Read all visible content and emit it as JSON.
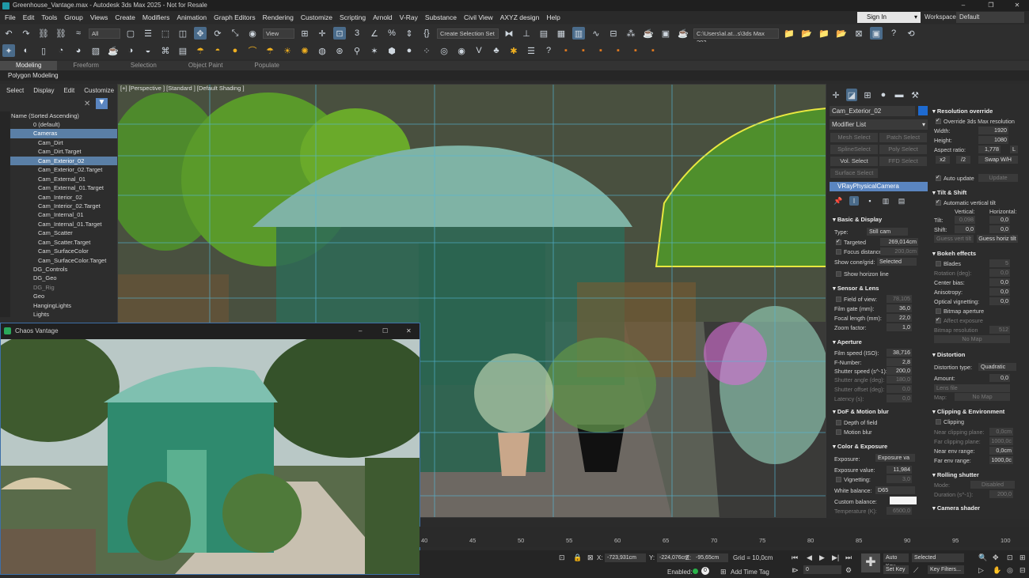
{
  "window": {
    "title": "Greenhouse_Vantage.max - Autodesk 3ds Max 2025 - Not for Resale"
  },
  "menu": [
    "File",
    "Edit",
    "Tools",
    "Group",
    "Views",
    "Create",
    "Modifiers",
    "Animation",
    "Graph Editors",
    "Rendering",
    "Customize",
    "Scripting",
    "Arnold",
    "V-Ray",
    "Substance",
    "Civil View",
    "AXYZ design",
    "Help"
  ],
  "account": {
    "sign_in": "Sign In",
    "workspaces_label": "Workspaces:",
    "workspace": "Default"
  },
  "toolbar": {
    "filter": "All",
    "view": "View",
    "selection_set": "Create Selection Set",
    "path": "C:\\Users\\al.at...s\\3ds Max 202"
  },
  "ribbon": {
    "tabs": [
      "Modeling",
      "Freeform",
      "Selection",
      "Object Paint",
      "Populate"
    ],
    "active": "Modeling",
    "subtitle": "Polygon Modeling"
  },
  "scene_explorer": {
    "menu": [
      "Select",
      "Display",
      "Edit",
      "Customize"
    ],
    "header": "Name (Sorted Ascending)",
    "items": [
      {
        "label": "0 (default)",
        "level": 1
      },
      {
        "label": "Cameras",
        "level": 1,
        "selected": true
      },
      {
        "label": "Cam_Dirt",
        "level": 2
      },
      {
        "label": "Cam_Dirt.Target",
        "level": 2
      },
      {
        "label": "Cam_Exterior_02",
        "level": 2,
        "selected": true
      },
      {
        "label": "Cam_Exterior_02.Target",
        "level": 2
      },
      {
        "label": "Cam_External_01",
        "level": 2
      },
      {
        "label": "Cam_External_01.Target",
        "level": 2
      },
      {
        "label": "Cam_Interior_02",
        "level": 2
      },
      {
        "label": "Cam_Interior_02.Target",
        "level": 2
      },
      {
        "label": "Cam_Internal_01",
        "level": 2
      },
      {
        "label": "Cam_Internal_01.Target",
        "level": 2
      },
      {
        "label": "Cam_Scatter",
        "level": 2
      },
      {
        "label": "Cam_Scatter.Target",
        "level": 2
      },
      {
        "label": "Cam_SurfaceColor",
        "level": 2
      },
      {
        "label": "Cam_SurfaceColor.Target",
        "level": 2
      },
      {
        "label": "DG_Controls",
        "level": 1
      },
      {
        "label": "DG_Geo",
        "level": 1
      },
      {
        "label": "DG_Rig",
        "level": 1,
        "dim": true
      },
      {
        "label": "Geo",
        "level": 1
      },
      {
        "label": "HangingLights",
        "level": 1
      },
      {
        "label": "Lights",
        "level": 1
      }
    ]
  },
  "viewport": {
    "label": "[+] [Perspective ] [Standard ] [Default Shading ]"
  },
  "vantage": {
    "title": "Chaos Vantage"
  },
  "command_panel": {
    "object_name": "Cam_Exterior_02",
    "modifier_list": "Modifier List",
    "buttons": [
      "Mesh Select",
      "Patch Select",
      "SplineSelect",
      "Poly Select",
      "Vol. Select",
      "FFD Select",
      "Surface Select"
    ],
    "stack_item": "VRayPhysicalCamera",
    "basic": {
      "title": "Basic & Display",
      "type_label": "Type:",
      "type": "Still cam",
      "targeted": "Targeted",
      "targeted_val": "269,014cm",
      "focus": "Focus distance",
      "focus_val": "200,0cm",
      "cone": "Show cone/grid:",
      "cone_val": "Selected",
      "horizon": "Show horizon line"
    },
    "sensor": {
      "title": "Sensor & Lens",
      "fov": "Field of view:",
      "fov_val": "78,105",
      "film": "Film gate (mm):",
      "film_val": "36,0",
      "focal": "Focal length (mm):",
      "focal_val": "22,0",
      "zoom": "Zoom factor:",
      "zoom_val": "1,0"
    },
    "aperture": {
      "title": "Aperture",
      "iso": "Film speed (ISO):",
      "iso_val": "38,716",
      "fnum": "F-Number:",
      "fnum_val": "2,8",
      "shutter": "Shutter speed (s^-1):",
      "shutter_val": "200,0",
      "angle": "Shutter angle (deg):",
      "angle_val": "180,0",
      "offset": "Shutter offset (deg):",
      "offset_val": "0,0",
      "latency": "Latency (s):",
      "latency_val": "0,0"
    },
    "dof": {
      "title": "DoF & Motion blur",
      "depth": "Depth of field",
      "motion": "Motion blur"
    },
    "color": {
      "title": "Color & Exposure",
      "exposure": "Exposure:",
      "exposure_val": "Exposure va",
      "ev": "Exposure value:",
      "ev_val": "11,984",
      "vign": "Vignetting:",
      "vign_val": "3,0",
      "wb": "White balance:",
      "wb_val": "D65",
      "custom": "Custom balance:",
      "temp": "Temperature (K):",
      "temp_val": "6500,0"
    },
    "resolution": {
      "title": "Resolution override",
      "override": "Override 3ds Max resolution",
      "width": "Width:",
      "width_val": "1920",
      "height": "Height:",
      "height_val": "1080",
      "aspect": "Aspect ratio:",
      "aspect_val": "1,778",
      "l": "L",
      "x2": "x2",
      "d2": "/2",
      "swap": "Swap W/H",
      "auto": "Auto update",
      "update": "Update"
    },
    "tilt": {
      "title": "Tilt & Shift",
      "auto": "Automatic vertical tilt",
      "vertical": "Vertical:",
      "horizontal": "Horizontal:",
      "tilt": "Tilt:",
      "tilt_v": "0,098",
      "tilt_h": "0,0",
      "shift": "Shift:",
      "shift_v": "0,0",
      "shift_h": "0,0",
      "guess_v": "Guess vert tilt",
      "guess_h": "Guess horiz tilt"
    },
    "bokeh": {
      "title": "Bokeh effects",
      "blades": "Blades",
      "blades_val": "5",
      "rotation": "Rotation (deg):",
      "rotation_val": "0,0",
      "center": "Center bias:",
      "center_val": "0,0",
      "aniso": "Anisotropy:",
      "aniso_val": "0,0",
      "optical": "Optical vignetting:",
      "optical_val": "0,0",
      "bitmap": "Bitmap aperture",
      "affect": "Affect exposure",
      "bres": "Bitmap resolution",
      "bres_val": "512",
      "nomap": "No Map"
    },
    "distortion": {
      "title": "Distortion",
      "type": "Distortion type:",
      "type_val": "Quadratic",
      "amount": "Amount:",
      "amount_val": "0,0",
      "lens": "Lens file",
      "map": "Map:",
      "nomap": "No Map"
    },
    "clipping": {
      "title": "Clipping & Environment",
      "clip": "Clipping",
      "near": "Near clipping plane:",
      "near_val": "0,0cm",
      "far": "Far clipping plane:",
      "far_val": "1000,0c",
      "nenv": "Near env range:",
      "nenv_val": "0,0cm",
      "fenv": "Far env range:",
      "fenv_val": "1000,0c"
    },
    "rolling": {
      "title": "Rolling shutter",
      "mode": "Mode:",
      "mode_val": "Disabled",
      "duration": "Duration (s^-1):",
      "duration_val": "200,0"
    },
    "shader": {
      "title": "Camera shader"
    }
  },
  "timeline": {
    "ticks": [
      "40",
      "45",
      "50",
      "55",
      "60",
      "65",
      "70",
      "75",
      "80",
      "85",
      "90",
      "95",
      "100"
    ]
  },
  "status": {
    "x": "-723,931cm",
    "y": "-224,076cm",
    "z": "-95,65cm",
    "grid": "Grid = 10,0cm",
    "enabled": "Enabled:",
    "add_time_tag": "Add Time Tag",
    "auto_key": "Auto Key",
    "selected": "Selected",
    "set_key": "Set Key",
    "key_filters": "Key Filters...",
    "frame": "0"
  },
  "colors": {
    "accent": "#5a85c0",
    "vantage_border": "#3d6fa8",
    "selection_yellow": "#e8e840"
  }
}
